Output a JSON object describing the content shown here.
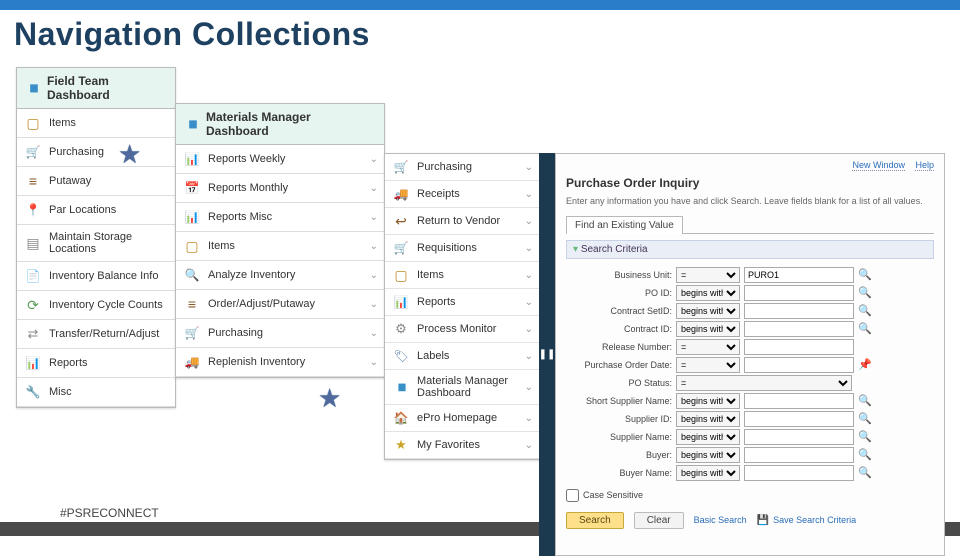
{
  "page_title": "Navigation Collections",
  "hashtag": "#PSRECONNECT",
  "col1": {
    "header": "Field Team Dashboard",
    "items": [
      {
        "label": "Items",
        "icon": "ic-box"
      },
      {
        "label": "Purchasing",
        "icon": "ic-cart"
      },
      {
        "label": "Putaway",
        "icon": "ic-shelf"
      },
      {
        "label": "Par Locations",
        "icon": "ic-pin"
      },
      {
        "label": "Maintain Storage Locations",
        "icon": "ic-grid"
      },
      {
        "label": "Inventory Balance Info",
        "icon": "ic-doc"
      },
      {
        "label": "Inventory Cycle Counts",
        "icon": "ic-cycle"
      },
      {
        "label": "Transfer/Return/Adjust",
        "icon": "ic-arrows"
      },
      {
        "label": "Reports",
        "icon": "ic-report"
      },
      {
        "label": "Misc",
        "icon": "ic-wrench"
      }
    ]
  },
  "col2": {
    "header": "Materials Manager Dashboard",
    "items": [
      {
        "label": "Reports Weekly",
        "icon": "ic-report"
      },
      {
        "label": "Reports Monthly",
        "icon": "ic-cal"
      },
      {
        "label": "Reports Misc",
        "icon": "ic-report"
      },
      {
        "label": "Items",
        "icon": "ic-box"
      },
      {
        "label": "Analyze Inventory",
        "icon": "ic-eye"
      },
      {
        "label": "Order/Adjust/Putaway",
        "icon": "ic-shelf"
      },
      {
        "label": "Purchasing",
        "icon": "ic-cart"
      },
      {
        "label": "Replenish Inventory",
        "icon": "ic-truck"
      }
    ]
  },
  "col3": {
    "items": [
      {
        "label": "Purchasing",
        "icon": "ic-cart"
      },
      {
        "label": "Receipts",
        "icon": "ic-truck"
      },
      {
        "label": "Return to Vendor",
        "icon": "ic-undo"
      },
      {
        "label": "Requisitions",
        "icon": "ic-cart"
      },
      {
        "label": "Items",
        "icon": "ic-box"
      },
      {
        "label": "Reports",
        "icon": "ic-report"
      },
      {
        "label": "Process Monitor",
        "icon": "ic-gear"
      },
      {
        "label": "Labels",
        "icon": "ic-label"
      },
      {
        "label": "Materials Manager Dashboard",
        "icon": "ic-chart"
      },
      {
        "label": "ePro Homepage",
        "icon": "ic-home"
      },
      {
        "label": "My Favorites",
        "icon": "ic-star"
      }
    ]
  },
  "rpane": {
    "top_links": {
      "new_window": "New Window",
      "help": "Help"
    },
    "title": "Purchase Order Inquiry",
    "desc": "Enter any information you have and click Search. Leave fields blank for a list of all values.",
    "tab": "Find an Existing Value",
    "search_criteria_label": "Search Criteria",
    "fields": [
      {
        "label": "Business Unit:",
        "op": "=",
        "value": "PURO1",
        "lookup": true
      },
      {
        "label": "PO ID:",
        "op": "begins with",
        "value": "",
        "lookup": true
      },
      {
        "label": "Contract SetID:",
        "op": "begins with",
        "value": "",
        "lookup": true
      },
      {
        "label": "Contract ID:",
        "op": "begins with",
        "value": "",
        "lookup": true
      },
      {
        "label": "Release Number:",
        "op": "=",
        "value": ""
      },
      {
        "label": "Purchase Order Date:",
        "op": "=",
        "value": "",
        "pin": true
      },
      {
        "label": "PO Status:",
        "op": "=",
        "value": "",
        "wideselect": true
      },
      {
        "label": "Short Supplier Name:",
        "op": "begins with",
        "value": "",
        "lookup": true
      },
      {
        "label": "Supplier ID:",
        "op": "begins with",
        "value": "",
        "lookup": true
      },
      {
        "label": "Supplier Name:",
        "op": "begins with",
        "value": "",
        "lookup": true
      },
      {
        "label": "Buyer:",
        "op": "begins with",
        "value": "",
        "lookup": true
      },
      {
        "label": "Buyer Name:",
        "op": "begins with",
        "value": "",
        "lookup": true
      }
    ],
    "case_sensitive": "Case Sensitive",
    "buttons": {
      "search": "Search",
      "clear": "Clear"
    },
    "links": {
      "basic": "Basic Search",
      "save": "Save Search Criteria"
    }
  }
}
